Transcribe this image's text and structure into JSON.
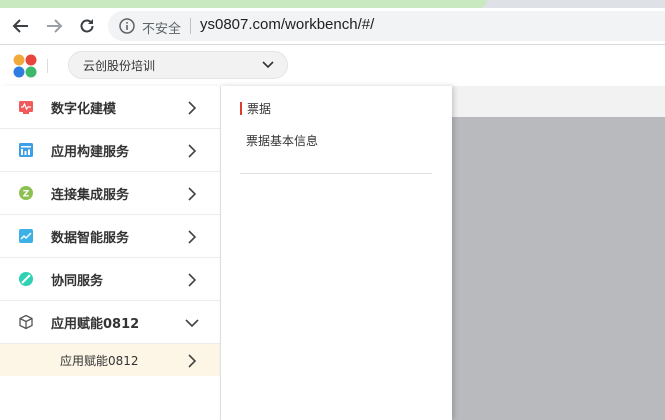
{
  "browser": {
    "security_label": "不安全",
    "url": "ys0807.com/workbench/#/"
  },
  "header": {
    "org_name": "云创股份培训"
  },
  "menu": {
    "items": [
      {
        "label": "数字化建模",
        "icon": "modeling-icon",
        "expanded": false
      },
      {
        "label": "应用构建服务",
        "icon": "app-build-icon",
        "expanded": false
      },
      {
        "label": "连接集成服务",
        "icon": "integration-icon",
        "expanded": false
      },
      {
        "label": "数据智能服务",
        "icon": "data-intelligence-icon",
        "expanded": false
      },
      {
        "label": "协同服务",
        "icon": "collaboration-icon",
        "expanded": false
      },
      {
        "label": "应用赋能0812",
        "icon": "cube-icon",
        "expanded": true
      }
    ],
    "sub_item": {
      "label": "应用赋能0812"
    }
  },
  "panel": {
    "section_title": "票据",
    "links": [
      "票据基本信息"
    ]
  },
  "colors": {
    "accent": "#e03b2f",
    "selected_bg": "#fdf6e7",
    "backdrop": "#b8babd"
  }
}
